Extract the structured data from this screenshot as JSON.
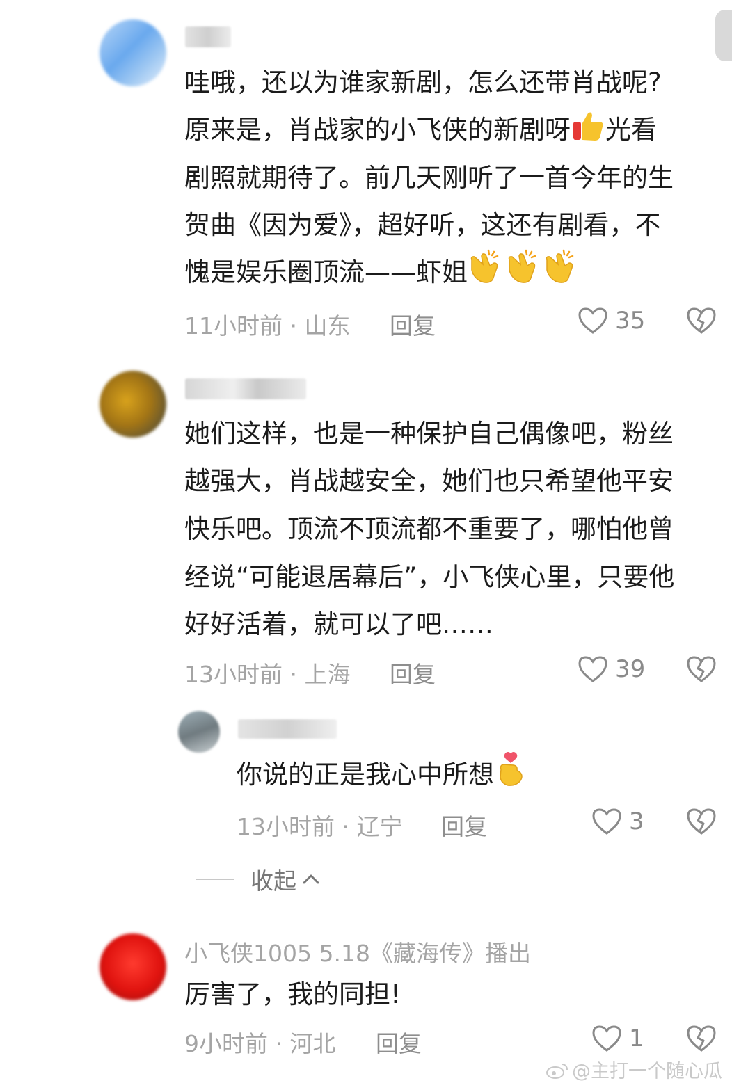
{
  "comments": [
    {
      "lines": [
        "哇哦，还以为谁家新剧，怎么还带肖战呢?",
        "原来是，肖战家的小飞侠的新剧呀",
        "光看",
        "剧照就期待了。前几天刚听了一首今年的生",
        "贺曲《因为爱》，超好听，这还有剧看，不",
        "愧是娱乐圈顶流——虾姐"
      ],
      "time_location": "11小时前 · 山东",
      "reply_label": "回复",
      "likes": "35",
      "emojis": [
        "thumbs-up",
        "clapping-hands",
        "clapping-hands",
        "clapping-hands"
      ]
    },
    {
      "lines": [
        "她们这样，也是一种保护自己偶像吧，粉丝",
        "越强大，肖战越安全，她们也只希望他平安",
        "快乐吧。顶流不顶流都不重要了，哪怕他曾",
        "经说“可能退居幕后”，小飞侠心里，只要他",
        "好好活着，就可以了吧……"
      ],
      "time_location": "13小时前 · 上海",
      "reply_label": "回复",
      "likes": "39"
    },
    {
      "text": "你说的正是我心中所想",
      "emoji": "finger-heart",
      "time_location": "13小时前 · 辽宁",
      "reply_label": "回复",
      "likes": "3"
    },
    {
      "username": "小飞侠1005  5.18《藏海传》播出",
      "text": "厉害了，我的同担!",
      "time_location": "9小时前 · 河北",
      "reply_label": "回复",
      "likes": "1"
    }
  ],
  "collapse_label": "收起",
  "watermark": "@主打一个随心瓜",
  "colors": {
    "meta_text": "#a4a4a4",
    "body_text": "#1b1b1b",
    "emoji_yellow": "#f6c32d",
    "thumb_red": "#e53935"
  }
}
